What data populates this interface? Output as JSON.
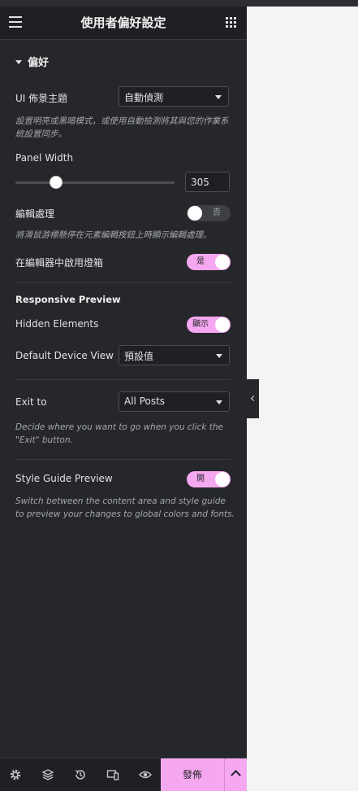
{
  "header": {
    "title": "使用者偏好設定"
  },
  "section": {
    "title": "偏好"
  },
  "ui_theme": {
    "label": "UI 佈景主題",
    "value": "自動偵測",
    "description": "設置明亮或黑暗模式，或使用自動檢測將其與您的作業系統設置同步。"
  },
  "panel_width": {
    "label": "Panel Width",
    "value": "305",
    "slider_fraction": 0.25
  },
  "edit_handles": {
    "label": "編輯處理",
    "state": "否",
    "description": "將滑鼠游標懸停在元素編輯按鈕上時顯示編輯處理。"
  },
  "lightbox": {
    "label": "在編輯器中啟用燈箱",
    "state": "是"
  },
  "responsive": {
    "title": "Responsive Preview",
    "hidden_elements": {
      "label": "Hidden Elements",
      "state": "顯示"
    },
    "default_device": {
      "label": "Default Device View",
      "value": "預設值"
    }
  },
  "exit_to": {
    "label": "Exit to",
    "value": "All Posts",
    "description": "Decide where you want to go when you click the \"Exit\" button."
  },
  "style_guide": {
    "label": "Style Guide Preview",
    "state": "開",
    "description": "Switch between the content area and style guide to preview your changes to global colors and fonts."
  },
  "footer": {
    "publish_label": "發佈",
    "icons": [
      "gear-icon",
      "layers-icon",
      "history-icon",
      "responsive-icon",
      "eye-icon"
    ]
  },
  "colors": {
    "accent": "#f5a8f0",
    "panel_bg": "#26272b",
    "header_bg": "#1f2024"
  }
}
